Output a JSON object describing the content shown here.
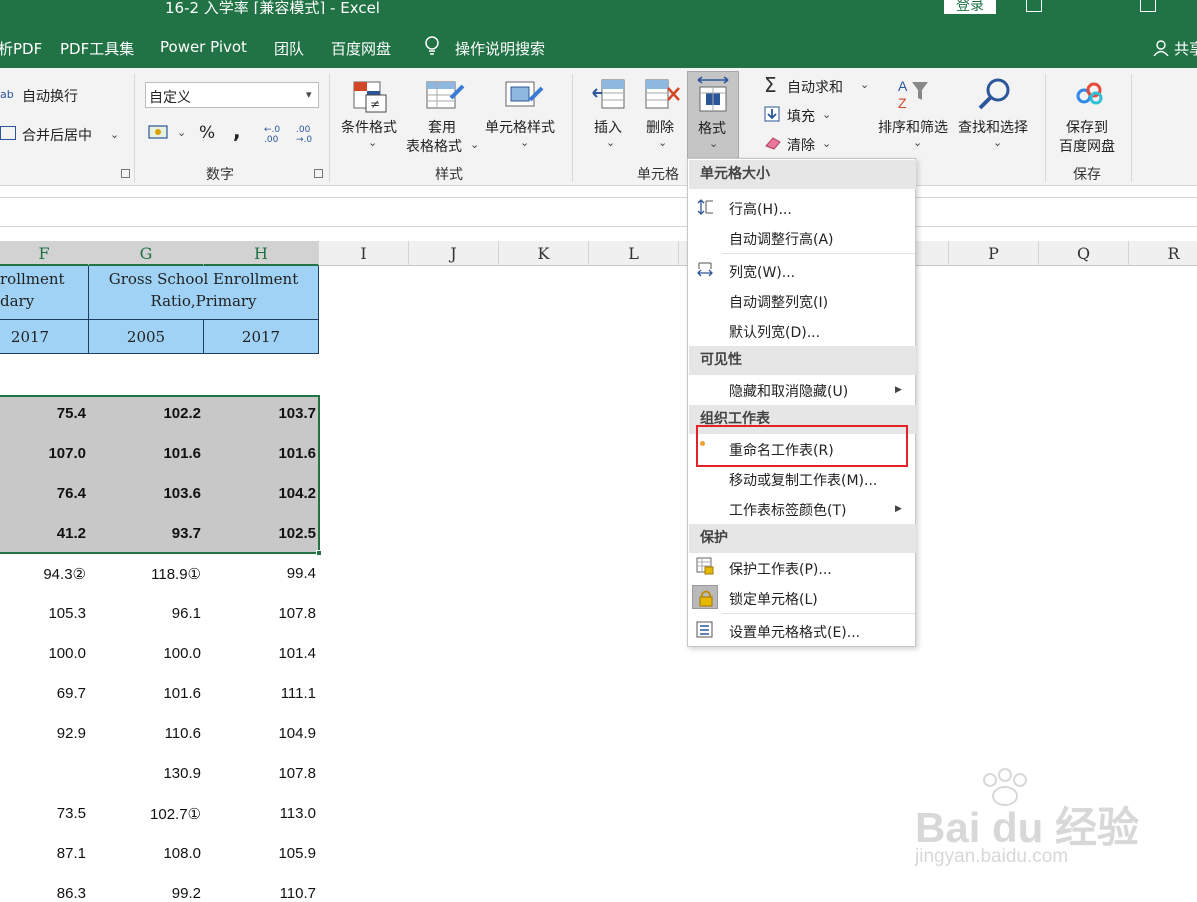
{
  "window": {
    "title": "16-2 入学率  [兼容模式]  -  Excel",
    "login_label": "登录"
  },
  "menu": {
    "items": [
      "析PDF",
      "PDF工具集",
      "Power Pivot",
      "团队",
      "百度网盘"
    ],
    "tell_me": "操作说明搜索",
    "share": "共享"
  },
  "ribbon": {
    "alignment": {
      "wrap_text": "自动换行",
      "merge_center": "合并后居中"
    },
    "number": {
      "format_value": "自定义",
      "percent": "%",
      "comma": ",",
      "inc_decimal": "←.0 .00",
      "dec_decimal": ".00 →.0",
      "group_label": "数字"
    },
    "styles": {
      "conditional_format": "条件格式",
      "format_table_line1": "套用",
      "format_table_line2": "表格格式",
      "cell_styles": "单元格样式",
      "group_label": "样式"
    },
    "cells": {
      "insert": "插入",
      "delete": "删除",
      "format": "格式",
      "group_label": "单元格"
    },
    "editing": {
      "autosum": "自动求和",
      "fill": "填充",
      "clear": "清除",
      "sort_filter": "排序和筛选",
      "find_select": "查找和选择"
    },
    "save": {
      "save_line1": "保存到",
      "save_line2": "百度网盘",
      "group_label": "保存"
    }
  },
  "columns": [
    "F",
    "G",
    "H",
    "I",
    "J",
    "K",
    "L",
    "P",
    "Q",
    "R"
  ],
  "table": {
    "header_f_line1": "rollment",
    "header_f_line2": "dary",
    "header_gh_line1": "Gross School Enrollment",
    "header_gh_line2": "Ratio,Primary",
    "years": [
      "2017",
      "2005",
      "2017"
    ]
  },
  "rows": [
    {
      "f": "75.4",
      "g": "102.2",
      "h": "103.7"
    },
    {
      "f": "107.0",
      "g": "101.6",
      "h": "101.6"
    },
    {
      "f": "76.4",
      "g": "103.6",
      "h": "104.2"
    },
    {
      "f": "41.2",
      "g": "93.7",
      "h": "102.5"
    },
    {
      "f": "94.3②",
      "g": "118.9①",
      "h": "99.4"
    },
    {
      "f": "105.3",
      "g": "96.1",
      "h": "107.8"
    },
    {
      "f": "100.0",
      "g": "100.0",
      "h": "101.4"
    },
    {
      "f": "69.7",
      "g": "101.6",
      "h": "111.1"
    },
    {
      "f": "92.9",
      "g": "110.6",
      "h": "104.9"
    },
    {
      "f": "",
      "g": "130.9",
      "h": "107.8"
    },
    {
      "f": "73.5",
      "g": "102.7①",
      "h": "113.0"
    },
    {
      "f": "87.1",
      "g": "108.0",
      "h": "105.9"
    },
    {
      "f": "86.3",
      "g": "99.2",
      "h": "110.7"
    }
  ],
  "context_menu": {
    "sec_size": "单元格大小",
    "row_height": "行高(H)...",
    "autofit_row": "自动调整行高(A)",
    "col_width": "列宽(W)...",
    "autofit_col": "自动调整列宽(I)",
    "default_width": "默认列宽(D)...",
    "sec_visibility": "可见性",
    "hide_unhide": "隐藏和取消隐藏(U)",
    "sec_organize": "组织工作表",
    "rename": "重命名工作表(R)",
    "move_copy": "移动或复制工作表(M)...",
    "tab_color": "工作表标签颜色(T)",
    "sec_protect": "保护",
    "protect_sheet": "保护工作表(P)...",
    "lock_cell": "锁定单元格(L)",
    "format_cells": "设置单元格格式(E)..."
  },
  "watermark": {
    "brand": "Bai du 经验",
    "url": "jingyan.baidu.com"
  },
  "colors": {
    "excel_green": "#217346",
    "header_blue": "#9fd2f5",
    "highlight_red": "#e52228"
  }
}
